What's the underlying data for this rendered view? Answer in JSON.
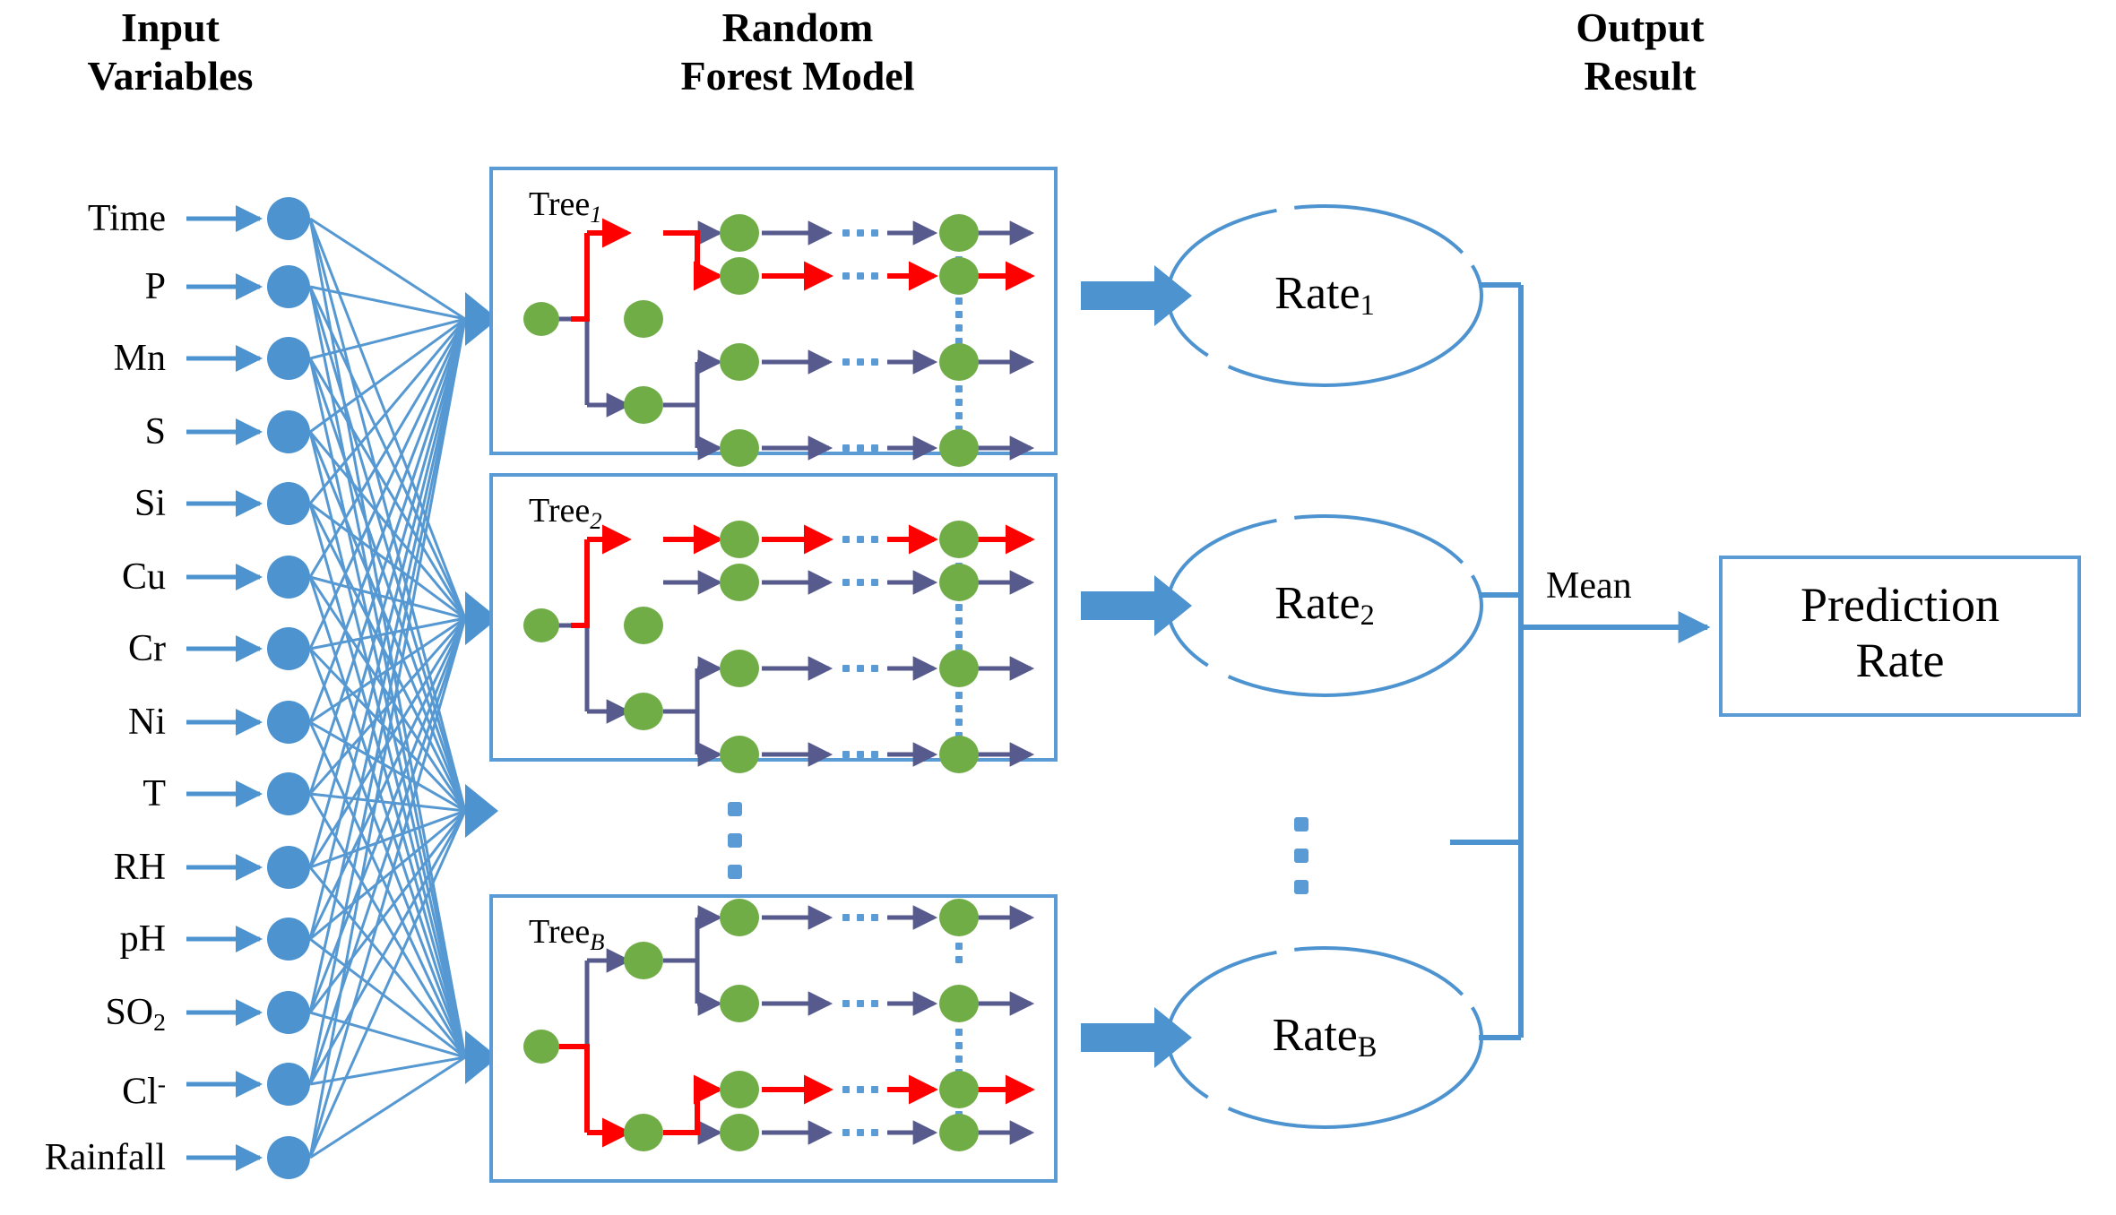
{
  "headers": {
    "input": "Input\nVariables",
    "model": "Random\nForest Model",
    "output": "Output\nResult"
  },
  "input_variables": [
    {
      "label": "Time",
      "sub": "",
      "sup": ""
    },
    {
      "label": "P",
      "sub": "",
      "sup": ""
    },
    {
      "label": "Mn",
      "sub": "",
      "sup": ""
    },
    {
      "label": "S",
      "sub": "",
      "sup": ""
    },
    {
      "label": "Si",
      "sub": "",
      "sup": ""
    },
    {
      "label": "Cu",
      "sub": "",
      "sup": ""
    },
    {
      "label": "Cr",
      "sub": "",
      "sup": ""
    },
    {
      "label": "Ni",
      "sub": "",
      "sup": ""
    },
    {
      "label": "T",
      "sub": "",
      "sup": ""
    },
    {
      "label": "RH",
      "sub": "",
      "sup": ""
    },
    {
      "label": "pH",
      "sub": "",
      "sup": ""
    },
    {
      "label": "SO",
      "sub": "2",
      "sup": ""
    },
    {
      "label": "Cl",
      "sub": "",
      "sup": "-"
    },
    {
      "label": "Rainfall",
      "sub": "",
      "sup": ""
    }
  ],
  "trees": [
    {
      "name": "Tree",
      "index": "1"
    },
    {
      "name": "Tree",
      "index": "2"
    },
    {
      "name": "Tree",
      "index": "B"
    }
  ],
  "tree_ellipsis": "⋮",
  "outputs": [
    {
      "label": "Rate",
      "sub": "1"
    },
    {
      "label": "Rate",
      "sub": "2"
    },
    {
      "label": "Rate",
      "sub": "B"
    }
  ],
  "output_ellipsis": "⋮",
  "aggregation": {
    "label": "Mean"
  },
  "prediction": {
    "label": "Prediction\nRate"
  },
  "colors": {
    "blue": "#4D93D0",
    "blue_node": "#4D93D0",
    "tree_border": "#5B9BD5",
    "green_node": "#70AD47",
    "purple_arrow": "#565A8C",
    "red_arrow": "#FF0000",
    "dot_blue": "#5B9BD5",
    "text": "#000000",
    "background": "#FFFFFF"
  }
}
